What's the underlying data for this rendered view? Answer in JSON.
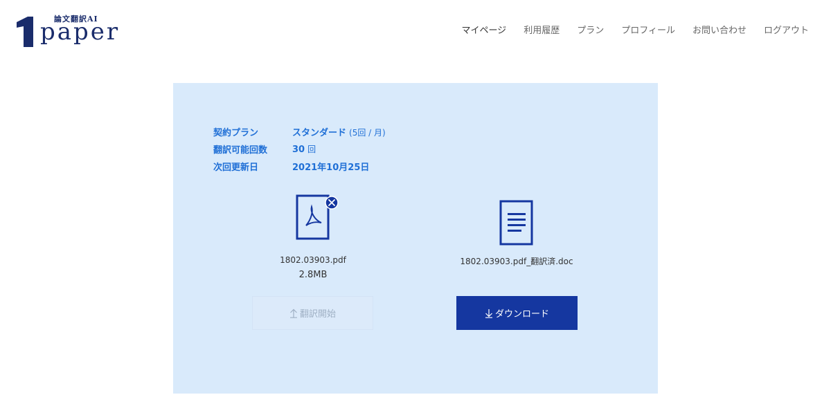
{
  "header": {
    "logo": {
      "subtitle": "論文翻訳AI",
      "wordmark": "paper"
    },
    "nav": [
      {
        "label": "マイページ"
      },
      {
        "label": "利用履歴"
      },
      {
        "label": "プラン"
      },
      {
        "label": "プロフィール"
      },
      {
        "label": "お問い合わせ"
      },
      {
        "label": "ログアウト"
      }
    ]
  },
  "plan_info": {
    "rows": [
      {
        "label": "契約プラン",
        "value": "スタンダード",
        "note": "(5回 / 月)"
      },
      {
        "label": "翻訳可能回数",
        "value": "30",
        "note": "回"
      },
      {
        "label": "次回更新日",
        "value": "2021年10月25日"
      }
    ]
  },
  "source_file": {
    "name": "1802.03903.pdf",
    "size": "2.8MB",
    "icon": "pdf-file-icon"
  },
  "translated_file": {
    "name": "1802.03903.pdf_翻訳済.doc",
    "icon": "document-file-icon"
  },
  "actions": {
    "start_label": "翻訳開始",
    "download_label": "ダウンロード"
  },
  "colors": {
    "brand": "#1a2c6b",
    "accent": "#1f6fd6",
    "panel_bg": "#d9eafb",
    "button": "#1537a0"
  }
}
